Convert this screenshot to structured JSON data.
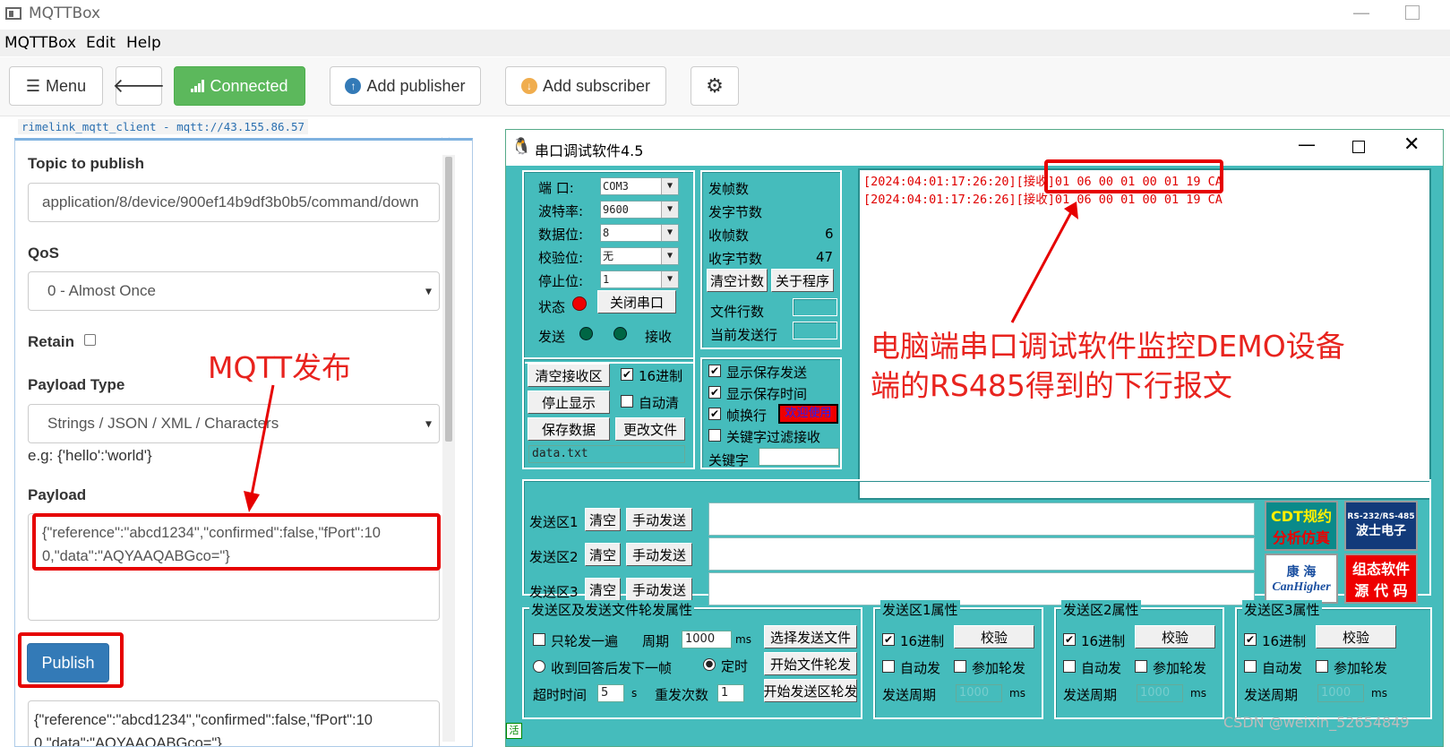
{
  "app": {
    "title": "MQTTBox",
    "menu": [
      "MQTTBox",
      "Edit",
      "Help"
    ]
  },
  "toolbar": {
    "menu_label": "Menu",
    "connected_label": "Connected",
    "add_publisher_label": "Add publisher",
    "add_subscriber_label": "Add subscriber"
  },
  "client_label": "rimelink_mqtt_client - mqtt://43.155.86.57",
  "publisher": {
    "topic_label": "Topic to publish",
    "topic_value": "application/8/device/900ef14b9df3b0b5/command/down",
    "qos_label": "QoS",
    "qos_value": "0 - Almost Once",
    "retain_label": "Retain",
    "payload_type_label": "Payload Type",
    "payload_type_value": "Strings / JSON / XML / Characters",
    "example": "e.g: {'hello':'world'}",
    "payload_label": "Payload",
    "payload_line1": "{\"reference\":\"abcd1234\",\"confirmed\":false,\"fPort\":10",
    "payload_line2": "0,\"data\":\"AQYAAQABGco=\"}",
    "publish_label": "Publish",
    "history_line1": "{\"reference\":\"abcd1234\",\"confirmed\":false,\"fPort\":10",
    "history_line2": "0,\"data\":\"AQYAAQABGco=\"}"
  },
  "annotations": {
    "mqtt": "MQTT发布",
    "serial_line1": "电脑端串口调试软件监控DEMO设备",
    "serial_line2": "端的RS485得到的下行报文",
    "watermark": "CSDN @weixin_52654849"
  },
  "serial": {
    "title": "串口调试软件4.5",
    "port_label": "端  口:",
    "port": "COM3",
    "baud_label": "波特率:",
    "baud": "9600",
    "databits_label": "数据位:",
    "databits": "8",
    "parity_label": "校验位:",
    "parity": "无",
    "stopbits_label": "停止位:",
    "stopbits": "1",
    "status_label": "状态",
    "close_port": "关闭串口",
    "send_label": "发送",
    "recv_label": "接收",
    "tx_frames": "发帧数",
    "tx_bytes": "发字节数",
    "rx_frames": "收帧数",
    "rx_frames_value": "6",
    "rx_bytes": "收字节数",
    "rx_bytes_value": "47",
    "clear_count": "清空计数",
    "about": "关于程序",
    "file_lines": "文件行数",
    "current_line": "当前发送行",
    "log": [
      "[2024:04:01:17:26:20][接收]01 06 00 01 00 01 19 CA",
      "[2024:04:01:17:26:26][接收]01 06 00 01 00 01 19 CA"
    ],
    "clear_recv": "清空接收区",
    "hex16": "16进制",
    "stop_display": "停止显示",
    "auto_clear": "自动清",
    "save_data": "保存数据",
    "change_file": "更改文件",
    "filename": "data.txt",
    "show_save_send": "显示保存发送",
    "show_save_time": "显示保存时间",
    "frame_newline": "帧换行",
    "welcome": "欢迎使用",
    "keyword_filter": "关键字过滤接收",
    "keyword": "关键字",
    "send_zones": [
      "发送区1",
      "发送区2",
      "发送区3"
    ],
    "clear": "清空",
    "manual_send": "手动发送",
    "ads": [
      "CDT规约",
      "分析仿真",
      "RS-232/RS-485",
      "波士电子",
      "康 海",
      "CanHigher",
      "组态软件",
      "源 代 码"
    ],
    "rotation_title": "发送区及发送文件轮发属性",
    "once": "只轮发一遍",
    "period": "周期",
    "period_value": "1000",
    "ms": "ms",
    "choose_file": "选择发送文件",
    "after_reply": "收到回答后发下一帧",
    "timed": "定时",
    "start_file": "开始文件轮发",
    "timeout": "超时时间",
    "timeout_value": "5",
    "s": "s",
    "retries": "重发次数",
    "retries_value": "1",
    "start_zone": "开始发送区轮发",
    "zone1_props": "发送区1属性",
    "zone2_props": "发送区2属性",
    "zone3_props": "发送区3属性",
    "verify": "校验",
    "auto_send": "自动发",
    "join_rotation": "参加轮发",
    "send_period": "发送周期",
    "zone_period_value": "1000",
    "status_char": "活"
  },
  "colors": {
    "connected": "#5cb85c",
    "publish": "#337ab7",
    "annotation": "#e60000",
    "serial_bg": "#45bcbc"
  }
}
